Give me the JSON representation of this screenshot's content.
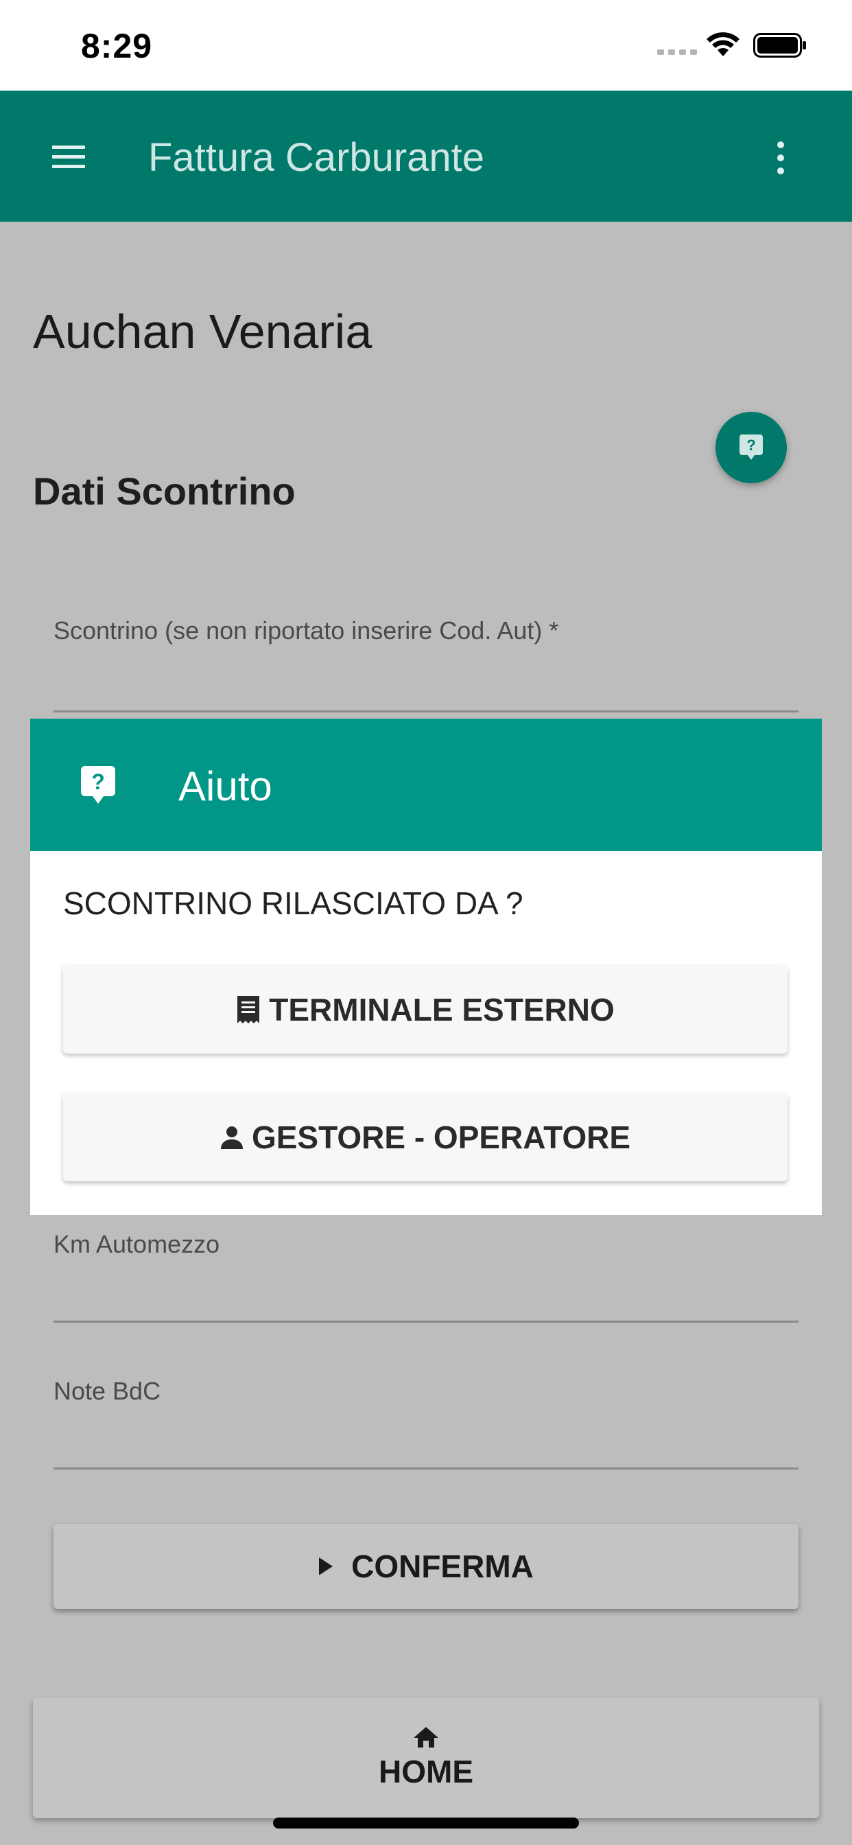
{
  "status_bar": {
    "time": "8:29"
  },
  "app_bar": {
    "title": "Fattura Carburante"
  },
  "station": {
    "name": "Auchan Venaria"
  },
  "section": {
    "title": "Dati Scontrino"
  },
  "fields": {
    "receipt_label": "Scontrino (se non riportato inserire Cod. Aut) *",
    "km_label": "Km Automezzo",
    "note_label": "Note BdC"
  },
  "actions": {
    "confirm_label": "CONFERMA",
    "home_label": "HOME"
  },
  "dialog": {
    "title": "Aiuto",
    "question": "SCONTRINO RILASCIATO DA ?",
    "options": [
      {
        "label": "TERMINALE ESTERNO",
        "icon": "receipt-icon"
      },
      {
        "label": "GESTORE - OPERATORE",
        "icon": "person-icon"
      }
    ]
  },
  "colors": {
    "primary": "#00796b",
    "dialog_header": "#009688",
    "scrim": "#bdbdbd"
  }
}
